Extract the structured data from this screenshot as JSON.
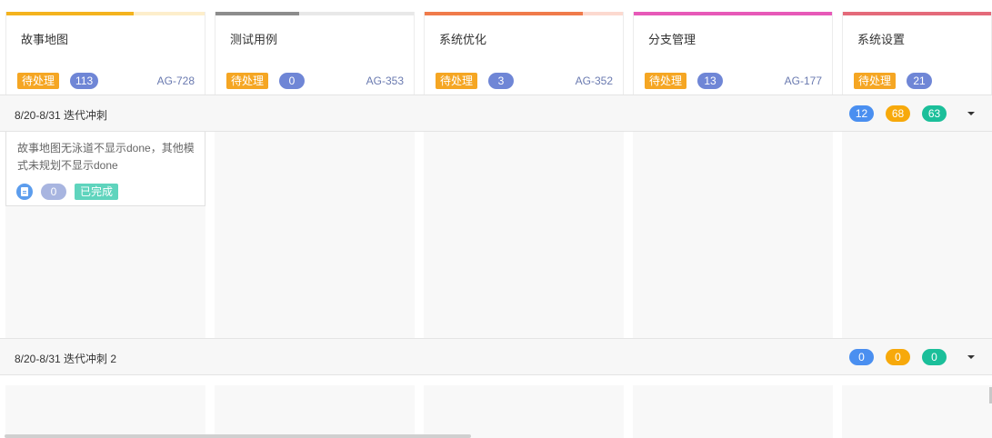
{
  "epics": [
    {
      "title": "故事地图",
      "status": "待处理",
      "count": "113",
      "key": "AG-728",
      "progress": 0.64,
      "color": "#f4b31e",
      "track": "#fdeecb"
    },
    {
      "title": "测试用例",
      "status": "待处理",
      "count": "0",
      "key": "AG-353",
      "progress": 0.42,
      "color": "#8c8c8c",
      "track": "#e8e8e8"
    },
    {
      "title": "系统优化",
      "status": "待处理",
      "count": "3",
      "key": "AG-352",
      "progress": 0.8,
      "color": "#f07b4b",
      "track": "#fcd9cf"
    },
    {
      "title": "分支管理",
      "status": "待处理",
      "count": "13",
      "key": "AG-177",
      "progress": 1.0,
      "color": "#e759b8",
      "track": "#f9d3ec"
    },
    {
      "title": "系统设置",
      "status": "待处理",
      "count": "21",
      "key": "",
      "progress": 1.0,
      "color": "#e46a7a",
      "track": "#f7d0d6"
    }
  ],
  "sprints": [
    {
      "name": "8/20-8/31 迭代冲刺",
      "todo": "12",
      "doing": "68",
      "done": "63"
    },
    {
      "name": "8/20-8/31 迭代冲刺 2",
      "todo": "0",
      "doing": "0",
      "done": "0"
    }
  ],
  "colors": {
    "todo": "#4a8ff0",
    "doing": "#f7a90b",
    "done": "#1bbf9a"
  },
  "story": {
    "text": "故事地图无泳道不显示done，其他模式未规划不显示done",
    "icon": "task-icon",
    "points": "0",
    "status": "已完成"
  }
}
